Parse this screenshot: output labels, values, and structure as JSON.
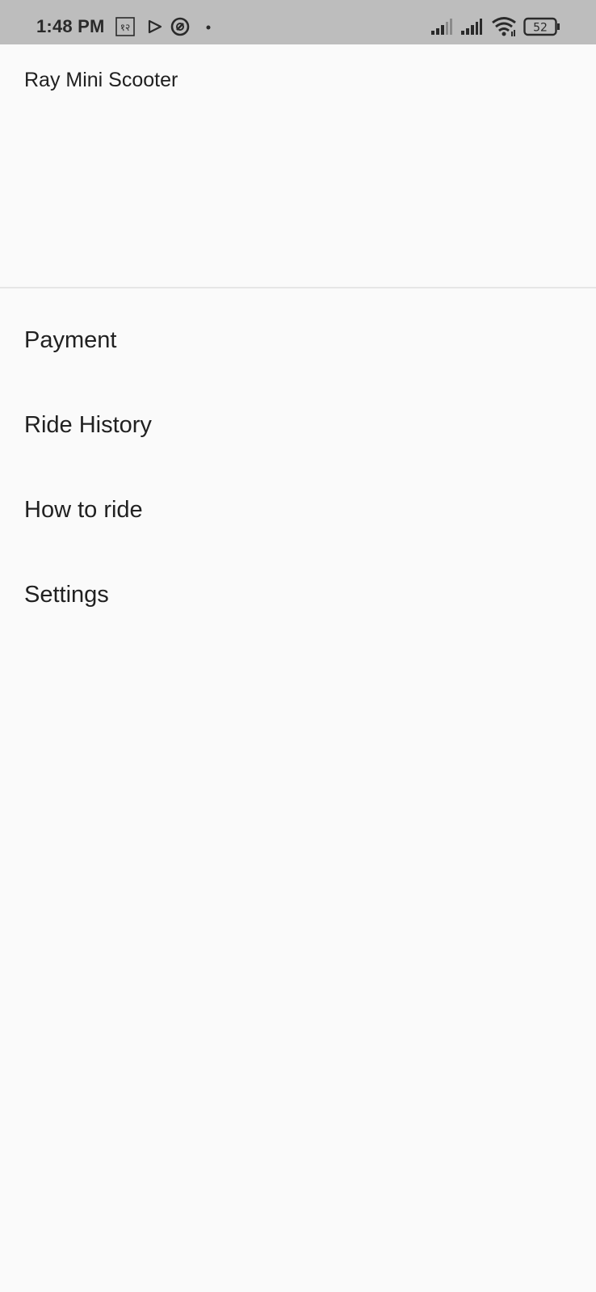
{
  "status_bar": {
    "time": "1:48 PM",
    "notification_icons": [
      "lang-icon",
      "play-icon",
      "blocked-icon",
      "dot-icon"
    ],
    "lang_glyph": "१२",
    "battery_level": "52",
    "status_icons": [
      "signal-icon",
      "signal-icon",
      "wifi-icon",
      "battery-icon"
    ]
  },
  "drawer": {
    "title": "Ray Mini Scooter",
    "menu_items": [
      {
        "label": "Payment"
      },
      {
        "label": "Ride History"
      },
      {
        "label": "How to ride"
      },
      {
        "label": "Settings"
      }
    ]
  },
  "colors": {
    "status_bar_bg": "#bdbdbd",
    "background": "#fafafa",
    "divider": "#e6e6e6",
    "text": "#212121"
  }
}
